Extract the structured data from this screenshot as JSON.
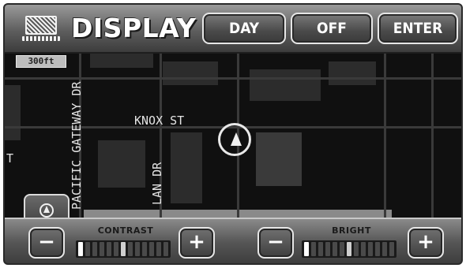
{
  "header": {
    "title": "DISPLAY",
    "buttons": {
      "day": "DAY",
      "off": "OFF",
      "enter": "ENTER"
    }
  },
  "map": {
    "badge": "300ft",
    "streets": {
      "knox": "KNOX ST",
      "pacific": "PACIFIC GATEWAY DR",
      "lan": "LAN DR",
      "fragment_t": "T"
    }
  },
  "controls": {
    "contrast": {
      "label": "CONTRAST",
      "minus": "−",
      "plus": "+",
      "level": 0.5
    },
    "brightness": {
      "label": "BRIGHT",
      "minus": "−",
      "plus": "+",
      "level": 0.45
    }
  },
  "colors": {
    "accent": "#ffffff",
    "panel": "#555555",
    "map_bg": "#101010"
  }
}
